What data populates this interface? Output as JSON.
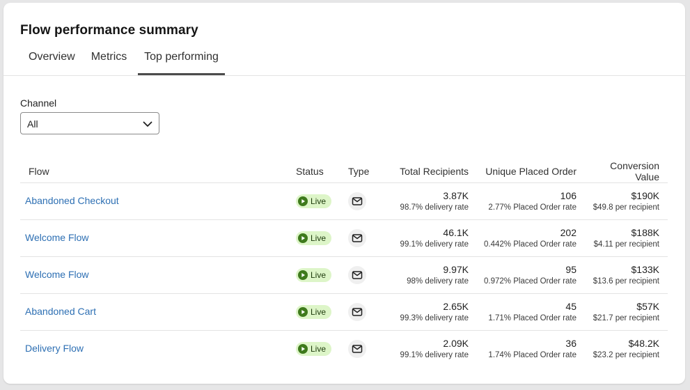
{
  "header": {
    "title": "Flow performance summary"
  },
  "tabs": [
    {
      "label": "Overview",
      "active": false
    },
    {
      "label": "Metrics",
      "active": false
    },
    {
      "label": "Top performing",
      "active": true
    }
  ],
  "filter": {
    "label": "Channel",
    "selected": "All",
    "icon": "chevron-down-icon"
  },
  "table": {
    "columns": [
      "Flow",
      "Status",
      "Type",
      "Total Recipients",
      "Unique Placed Order",
      "Conversion Value"
    ],
    "status_color": "#ddf5c8",
    "link_color": "#2d6fb3",
    "rows": [
      {
        "flow": "Abandoned Checkout",
        "status": "Live",
        "type_icon": "mail-icon",
        "recipients": "3.87K",
        "recipients_sub": "98.7% delivery rate",
        "orders": "106",
        "orders_sub": "2.77% Placed Order rate",
        "value": "$190K",
        "value_sub": "$49.8 per recipient"
      },
      {
        "flow": "Welcome Flow",
        "status": "Live",
        "type_icon": "mail-icon",
        "recipients": "46.1K",
        "recipients_sub": "99.1% delivery rate",
        "orders": "202",
        "orders_sub": "0.442% Placed Order rate",
        "value": "$188K",
        "value_sub": "$4.11 per recipient"
      },
      {
        "flow": "Welcome Flow",
        "status": "Live",
        "type_icon": "mail-icon",
        "recipients": "9.97K",
        "recipients_sub": "98% delivery rate",
        "orders": "95",
        "orders_sub": "0.972% Placed Order rate",
        "value": "$133K",
        "value_sub": "$13.6 per recipient"
      },
      {
        "flow": "Abandoned Cart",
        "status": "Live",
        "type_icon": "mail-icon",
        "recipients": "2.65K",
        "recipients_sub": "99.3% delivery rate",
        "orders": "45",
        "orders_sub": "1.71% Placed Order rate",
        "value": "$57K",
        "value_sub": "$21.7 per recipient"
      },
      {
        "flow": "Delivery Flow",
        "status": "Live",
        "type_icon": "mail-icon",
        "recipients": "2.09K",
        "recipients_sub": "99.1% delivery rate",
        "orders": "36",
        "orders_sub": "1.74% Placed Order rate",
        "value": "$48.2K",
        "value_sub": "$23.2 per recipient"
      }
    ]
  }
}
